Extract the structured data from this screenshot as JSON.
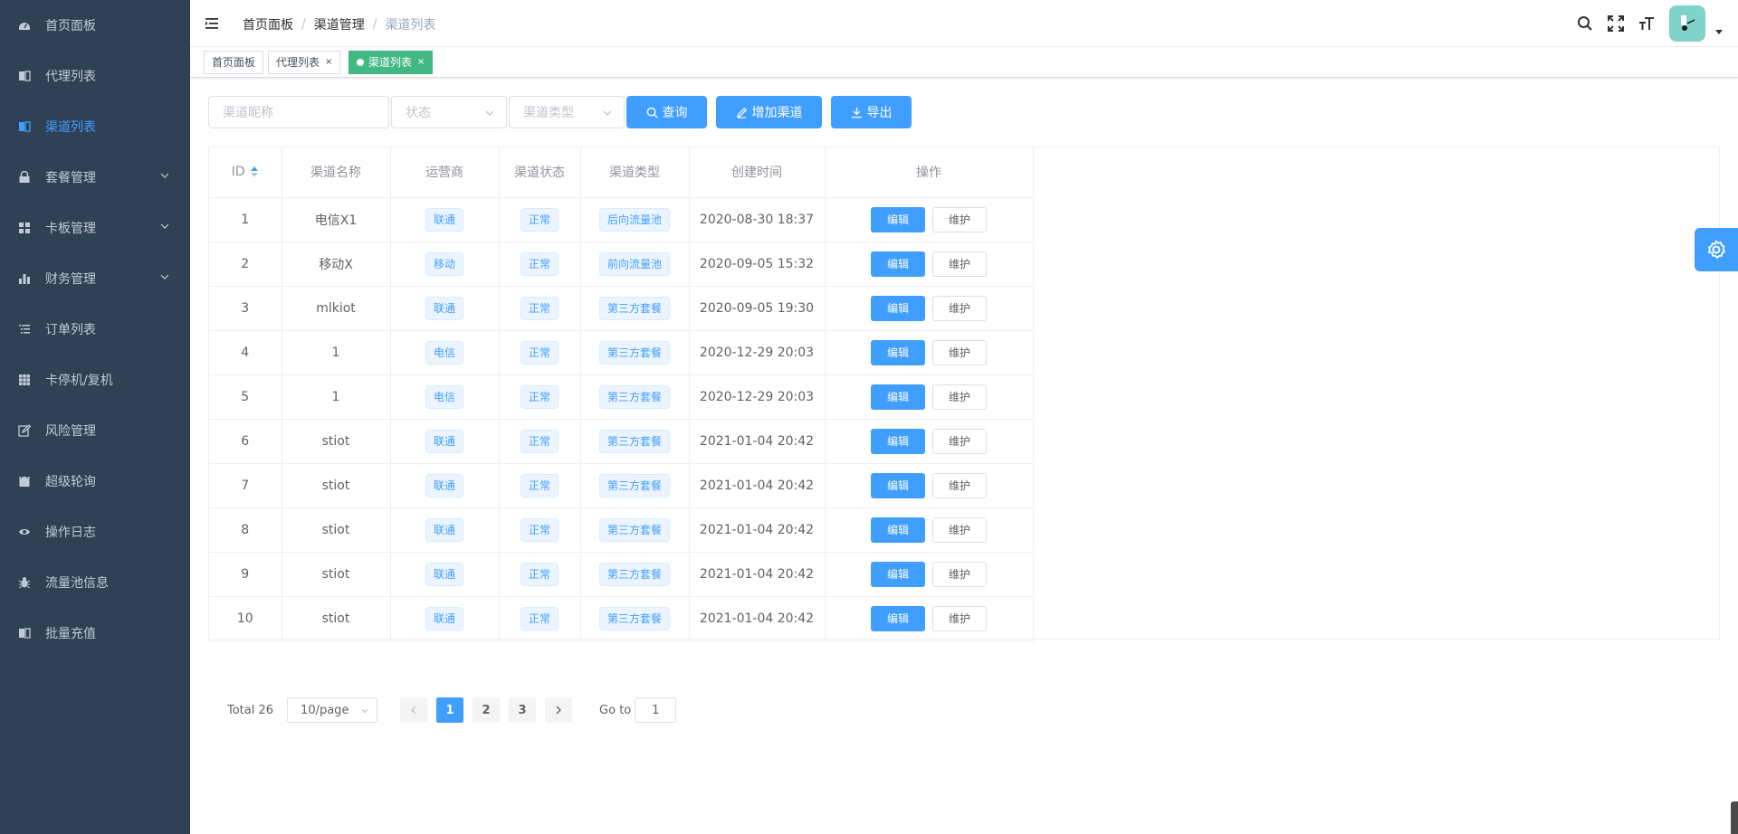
{
  "sidebar": {
    "items": [
      {
        "label": "首页面板",
        "icon": "dashboard-icon",
        "active": false,
        "submenu": false
      },
      {
        "label": "代理列表",
        "icon": "book-icon",
        "active": false,
        "submenu": false
      },
      {
        "label": "渠道列表",
        "icon": "book-icon",
        "active": true,
        "submenu": false
      },
      {
        "label": "套餐管理",
        "icon": "lock-icon",
        "active": false,
        "submenu": true
      },
      {
        "label": "卡板管理",
        "icon": "grid-icon",
        "active": false,
        "submenu": true
      },
      {
        "label": "财务管理",
        "icon": "bar-chart-icon",
        "active": false,
        "submenu": true
      },
      {
        "label": "订单列表",
        "icon": "list-icon",
        "active": false,
        "submenu": false
      },
      {
        "label": "卡停机/复机",
        "icon": "table-icon",
        "active": false,
        "submenu": false
      },
      {
        "label": "风险管理",
        "icon": "edit-icon",
        "active": false,
        "submenu": false
      },
      {
        "label": "超级轮询",
        "icon": "clipboard-icon",
        "active": false,
        "submenu": false
      },
      {
        "label": "操作日志",
        "icon": "eye-icon",
        "active": false,
        "submenu": false
      },
      {
        "label": "流量池信息",
        "icon": "bug-icon",
        "active": false,
        "submenu": false
      },
      {
        "label": "批量充值",
        "icon": "book-icon",
        "active": false,
        "submenu": false
      }
    ]
  },
  "header": {
    "breadcrumb": [
      "首页面板",
      "渠道管理",
      "渠道列表"
    ]
  },
  "tags": [
    {
      "label": "首页面板",
      "closable": false,
      "active": false
    },
    {
      "label": "代理列表",
      "closable": true,
      "active": false
    },
    {
      "label": "渠道列表",
      "closable": true,
      "active": true
    }
  ],
  "filter": {
    "name_placeholder": "渠道昵称",
    "status_placeholder": "状态",
    "type_placeholder": "渠道类型",
    "query_label": "查询",
    "add_label": "增加渠道",
    "export_label": "导出"
  },
  "table": {
    "columns": [
      "ID",
      "渠道名称",
      "运营商",
      "渠道状态",
      "渠道类型",
      "创建时间",
      "操作"
    ],
    "edit_label": "编辑",
    "maintain_label": "维护",
    "rows": [
      {
        "id": "1",
        "name": "电信X1",
        "carrier": "联通",
        "status": "正常",
        "type": "后向流量池",
        "created": "2020-08-30 18:37"
      },
      {
        "id": "2",
        "name": "移动X",
        "carrier": "移动",
        "status": "正常",
        "type": "前向流量池",
        "created": "2020-09-05 15:32"
      },
      {
        "id": "3",
        "name": "mlkiot",
        "carrier": "联通",
        "status": "正常",
        "type": "第三方套餐",
        "created": "2020-09-05 19:30"
      },
      {
        "id": "4",
        "name": "1",
        "carrier": "电信",
        "status": "正常",
        "type": "第三方套餐",
        "created": "2020-12-29 20:03"
      },
      {
        "id": "5",
        "name": "1",
        "carrier": "电信",
        "status": "正常",
        "type": "第三方套餐",
        "created": "2020-12-29 20:03"
      },
      {
        "id": "6",
        "name": "stiot",
        "carrier": "联通",
        "status": "正常",
        "type": "第三方套餐",
        "created": "2021-01-04 20:42"
      },
      {
        "id": "7",
        "name": "stiot",
        "carrier": "联通",
        "status": "正常",
        "type": "第三方套餐",
        "created": "2021-01-04 20:42"
      },
      {
        "id": "8",
        "name": "stiot",
        "carrier": "联通",
        "status": "正常",
        "type": "第三方套餐",
        "created": "2021-01-04 20:42"
      },
      {
        "id": "9",
        "name": "stiot",
        "carrier": "联通",
        "status": "正常",
        "type": "第三方套餐",
        "created": "2021-01-04 20:42"
      },
      {
        "id": "10",
        "name": "stiot",
        "carrier": "联通",
        "status": "正常",
        "type": "第三方套餐",
        "created": "2021-01-04 20:42"
      }
    ]
  },
  "pagination": {
    "total_label": "Total 26",
    "page_size": "10/page",
    "pages": [
      "1",
      "2",
      "3"
    ],
    "current_page": "1",
    "goto_label": "Go to",
    "goto_value": "1"
  },
  "colors": {
    "sidebar_bg": "#304156",
    "sidebar_text": "#bfcbd9",
    "primary": "#409eff",
    "active_tag": "#42b983"
  }
}
